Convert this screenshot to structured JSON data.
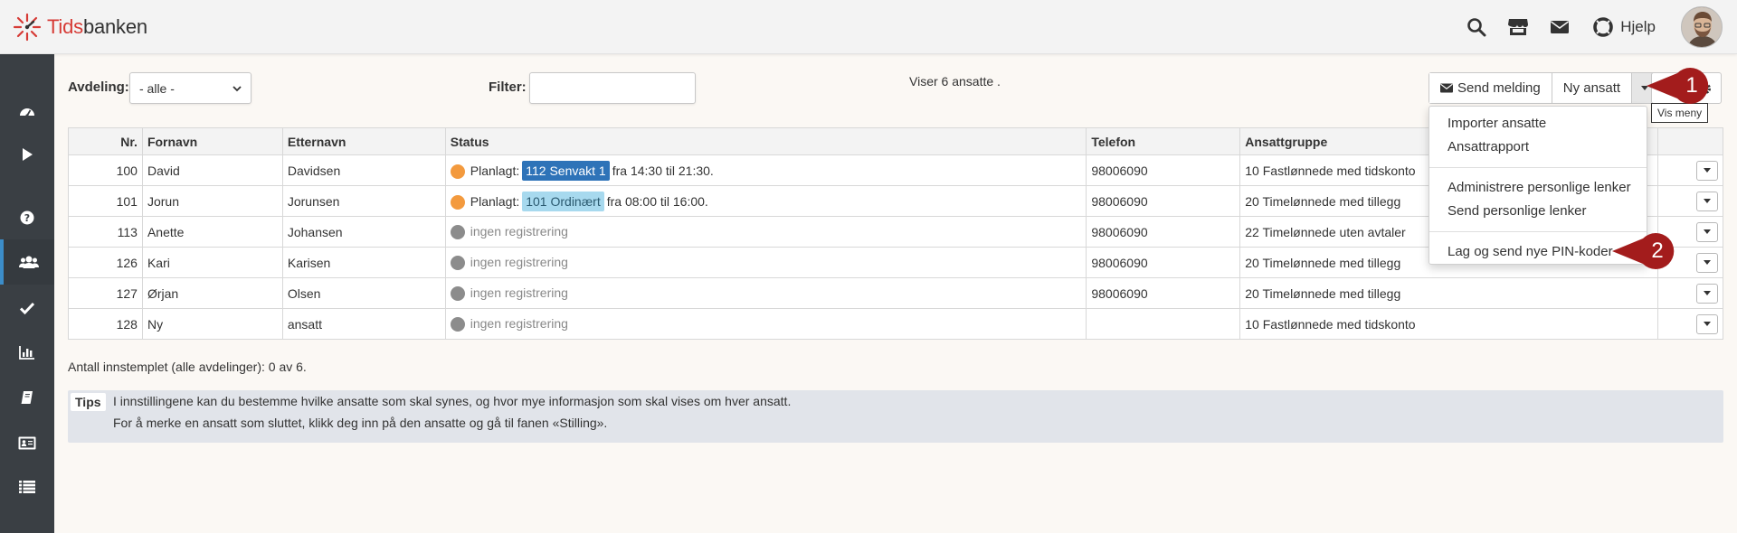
{
  "app": {
    "logo_prefix": "Tids",
    "logo_suffix": "banken",
    "help_label": "Hjelp"
  },
  "toolbar": {
    "department_label": "Avdeling:",
    "department_value": "- alle -",
    "filter_label": "Filter:",
    "filter_value": "",
    "count_text": "Viser 6 ansatte .",
    "send_message_label": "Send melding",
    "new_employee_label": "Ny ansatt",
    "tooltip": "Vis meny"
  },
  "menu": {
    "items": [
      "Importer ansatte",
      "Ansattrapport",
      "Administrere personlige lenker",
      "Send personlige lenker",
      "Lag og send nye PIN-koder"
    ]
  },
  "callouts": [
    "1",
    "2"
  ],
  "table": {
    "headers": [
      "Nr.",
      "Fornavn",
      "Etternavn",
      "Status",
      "Telefon",
      "Ansattgruppe"
    ],
    "rows": [
      {
        "nr": "100",
        "first": "David",
        "last": "Davidsen",
        "status_prefix": "Planlagt:",
        "shift": "112 Senvakt 1",
        "status_suffix": "fra 14:30 til 21:30.",
        "phone": "98006090",
        "group": "10 Fastlønnede med tidskonto"
      },
      {
        "nr": "101",
        "first": "Jorun",
        "last": "Jorunsen",
        "status_prefix": "Planlagt:",
        "shift": "101 Ordinært",
        "status_suffix": "fra 08:00 til 16:00.",
        "phone": "98006090",
        "group": "20 Timelønnede med tillegg"
      },
      {
        "nr": "113",
        "first": "Anette",
        "last": "Johansen",
        "status_text": "ingen registrering",
        "phone": "98006090",
        "group": "22 Timelønnede uten avtaler"
      },
      {
        "nr": "126",
        "first": "Kari",
        "last": "Karisen",
        "status_text": "ingen registrering",
        "phone": "98006090",
        "group": "20 Timelønnede med tillegg"
      },
      {
        "nr": "127",
        "first": "Ørjan",
        "last": "Olsen",
        "status_text": "ingen registrering",
        "phone": "98006090",
        "group": "20 Timelønnede med tillegg"
      },
      {
        "nr": "128",
        "first": "Ny",
        "last": "ansatt",
        "status_text": "ingen registrering",
        "phone": "",
        "group": "10 Fastlønnede med tidskonto"
      }
    ]
  },
  "footer": {
    "count_text": "Antall innstemplet (alle avdelinger): 0 av 6.",
    "tips_label": "Tips",
    "tips_line1": "I innstillingene kan du bestemme hvilke ansatte som skal synes, og hvor mye informasjon som skal vises om hver ansatt.",
    "tips_line2": "For å merke en ansatt som sluttet, klikk deg inn på den ansatte og gå til fanen «Stilling»."
  },
  "colors": {
    "accent": "#3c8dc9",
    "brand_red": "#d63a35",
    "sidebar": "#3a3f44",
    "planned_dot": "#f39a3e",
    "callout": "#a31c1c"
  },
  "icons": {
    "top": [
      "search-icon",
      "store-icon",
      "mail-icon",
      "lifebuoy-icon"
    ],
    "sidebar": [
      "dashboard-icon",
      "play-icon",
      "question-icon",
      "users-icon",
      "check-icon",
      "bar-chart-icon",
      "book-icon",
      "id-card-icon",
      "list-icon"
    ]
  }
}
